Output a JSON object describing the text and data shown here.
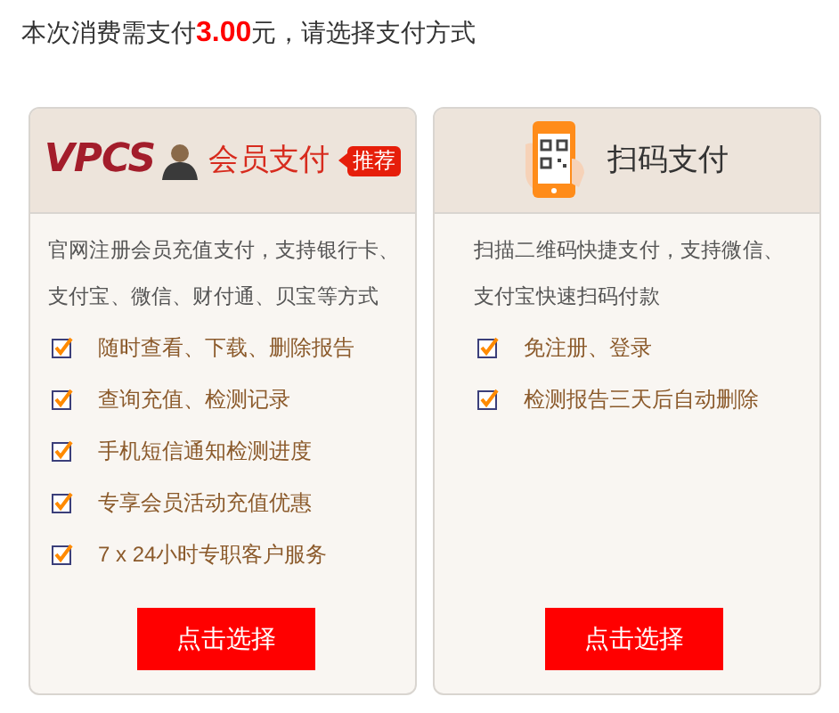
{
  "heading": {
    "prefix": "本次消费需支付",
    "amount": "3.00",
    "suffix": "元，请选择支付方式"
  },
  "options": [
    {
      "kind": "member",
      "logo": "VPCS",
      "title": "会员支付",
      "badge": "推荐",
      "description": "官网注册会员充值支付，支持银行卡、支付宝、微信、财付通、贝宝等方式",
      "features": [
        {
          "label": "随时查看、下载、删除报告",
          "checked": true
        },
        {
          "label": "查询充值、检测记录",
          "checked": true
        },
        {
          "label": "手机短信通知检测进度",
          "checked": true
        },
        {
          "label": "专享会员活动充值优惠",
          "checked": true
        },
        {
          "label": "7 x 24小时专职客户服务",
          "checked": true
        }
      ],
      "button": "点击选择"
    },
    {
      "kind": "scan",
      "title": "扫码支付",
      "description": "扫描二维码快捷支付，支持微信、支付宝快速扫码付款",
      "features": [
        {
          "label": "免注册、登录",
          "checked": true
        },
        {
          "label": "检测报告三天后自动删除",
          "checked": true
        }
      ],
      "button": "点击选择"
    }
  ]
}
